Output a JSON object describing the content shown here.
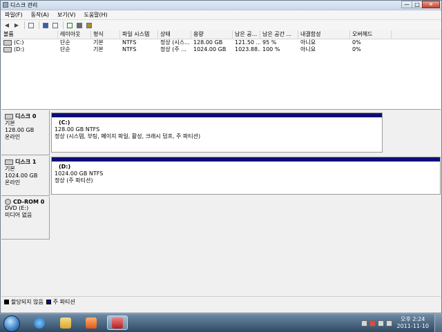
{
  "window": {
    "title": "디스크 관리",
    "buttons": {
      "minimize": "—",
      "maximize": "□",
      "close": "✕"
    }
  },
  "menubar": {
    "items": [
      "파일(F)",
      "동작(A)",
      "보기(V)",
      "도움말(H)"
    ]
  },
  "toolbar": {
    "icons": [
      "back-icon",
      "forward-icon",
      "console-tree-icon",
      "properties-icon",
      "help-icon",
      "view-icon",
      "refresh-icon",
      "disk-properties-icon",
      "settings-icon"
    ]
  },
  "volumes": {
    "headers": [
      "볼륨",
      "레이아웃",
      "형식",
      "파일 시스템",
      "상태",
      "용량",
      "남은 공...",
      "남은 공간 ...",
      "내결함성",
      "오버헤드"
    ],
    "rows": [
      [
        "(C:)",
        "단순",
        "기본",
        "NTFS",
        "정상 (시스...",
        "128.00 GB",
        "121.50 ...",
        "95 %",
        "아니요",
        "0%"
      ],
      [
        "(D:)",
        "단순",
        "기본",
        "NTFS",
        "정상 (주 ...",
        "1024.00 GB",
        "1023.88...",
        "100 %",
        "아니요",
        "0%"
      ]
    ]
  },
  "disks": [
    {
      "name": "디스크 0",
      "type": "기본",
      "size": "128.00 GB",
      "status": "온라인",
      "partition": {
        "label": "(C:)",
        "fs": "128.00 GB NTFS",
        "status": "정상 (시스템, 부팅, 페이지 파일, 활성, 크래시 덤프, 주 파티션)"
      }
    },
    {
      "name": "디스크 1",
      "type": "기본",
      "size": "1024.00 GB",
      "status": "온라인",
      "partition": {
        "label": "(D:)",
        "fs": "1024.00 GB NTFS",
        "status": "정상 (주 파티션)"
      }
    },
    {
      "name": "CD-ROM 0",
      "type": "DVD (E:)",
      "size": "",
      "status": "미디어 없음"
    }
  ],
  "legend": {
    "unallocated": "할당되지 않음",
    "primary": "주 파티션"
  },
  "colors": {
    "primary_partition": "#0d0d7a",
    "unallocated": "#000000"
  },
  "taskbar": {
    "items": [
      "start-button",
      "internet-explorer-icon",
      "explorer-icon",
      "media-player-icon",
      "computer-management-icon"
    ],
    "clock": {
      "time": "오후 2:24",
      "date": "2011-11-10"
    }
  }
}
